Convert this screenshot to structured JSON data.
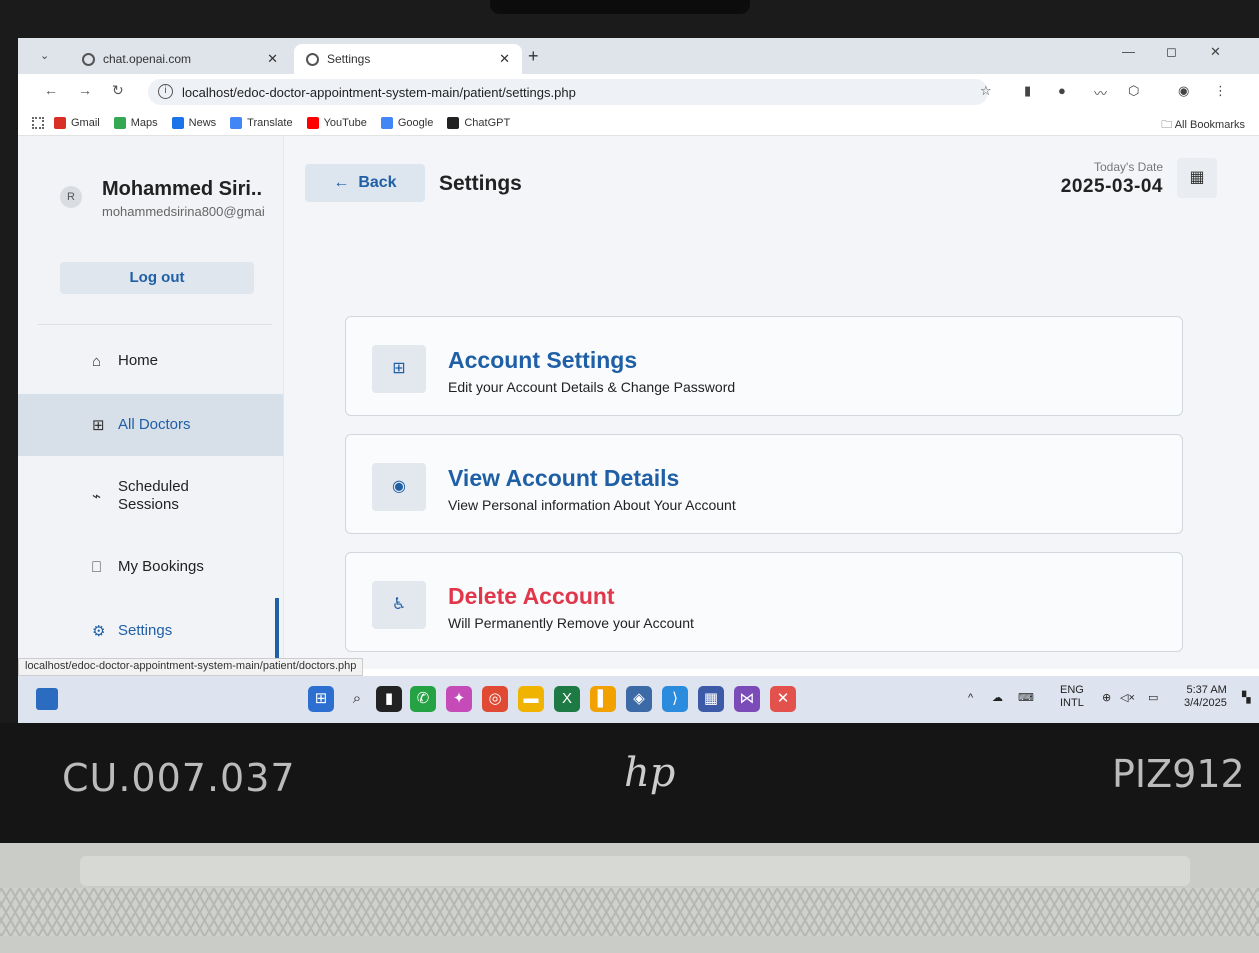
{
  "browser": {
    "tabs": [
      {
        "title": "chat.openai.com"
      },
      {
        "title": "Settings"
      }
    ],
    "url": "localhost/edoc-doctor-appointment-system-main/patient/settings.php",
    "bookmarks": [
      {
        "label": "Gmail",
        "color": "#d93025"
      },
      {
        "label": "Maps",
        "color": "#34a853"
      },
      {
        "label": "News",
        "color": "#1a73e8"
      },
      {
        "label": "Translate",
        "color": "#4285f4"
      },
      {
        "label": "YouTube",
        "color": "#ff0000"
      },
      {
        "label": "Google",
        "color": "#4285f4"
      },
      {
        "label": "ChatGPT",
        "color": "#222222"
      }
    ],
    "all_bookmarks": "All Bookmarks",
    "status_url": "localhost/edoc-doctor-appointment-system-main/patient/doctors.php"
  },
  "sidebar": {
    "avatar": "R",
    "name": "Mohammed Siri..",
    "email": "mohammedsirina800@gmai",
    "logout_label": "Log out",
    "items": [
      {
        "label": "Home",
        "icon": "home-icon"
      },
      {
        "label": "All Doctors",
        "icon": "doctor-icon"
      },
      {
        "label": "Scheduled Sessions",
        "icon": "session-icon"
      },
      {
        "label": "My Bookings",
        "icon": "bookmark-icon"
      },
      {
        "label": "Settings",
        "icon": "settings-icon"
      }
    ]
  },
  "header": {
    "back_label": "Back",
    "title": "Settings",
    "date_label": "Today's Date",
    "date_value": "2025-03-04"
  },
  "cards": [
    {
      "title": "Account Settings",
      "subtitle": "Edit your Account Details & Change Password",
      "icon": "doctor-icon"
    },
    {
      "title": "View Account Details",
      "subtitle": "View Personal information About Your Account",
      "icon": "eye-icon"
    },
    {
      "title": "Delete Account",
      "subtitle": "Will Permanently Remove your Account",
      "icon": "accessible-icon"
    }
  ],
  "taskbar": {
    "lang": "ENG",
    "lang_sub": "INTL",
    "time": "5:37 AM",
    "date": "3/4/2025"
  },
  "laptop": {
    "sticker_left": "CU.007.037",
    "sticker_right": "PIZ912",
    "brand": "hp"
  },
  "colors": {
    "accent": "#1f5fa6",
    "danger": "#e0374a"
  }
}
